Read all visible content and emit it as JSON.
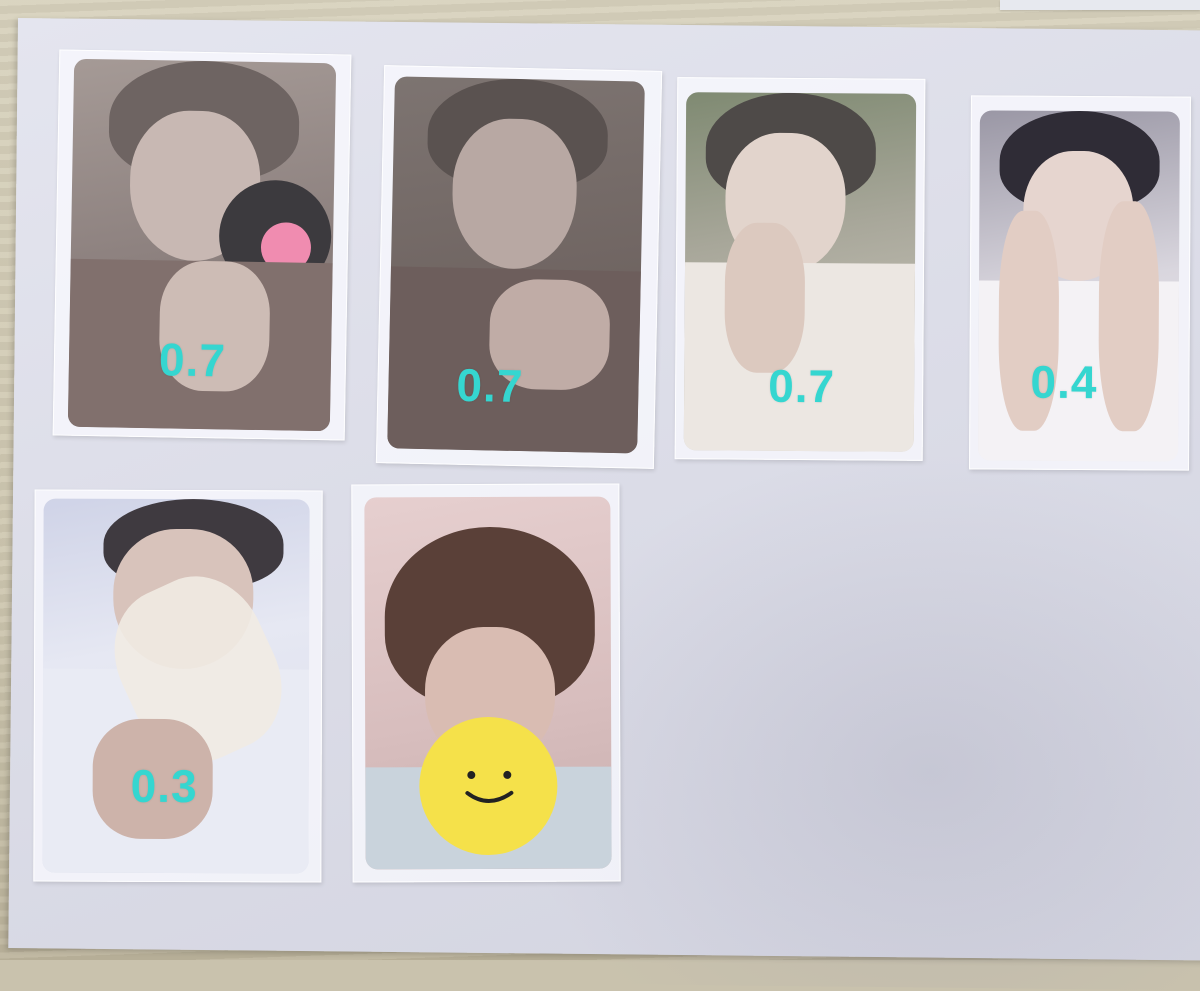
{
  "cards": [
    {
      "price": "0.7"
    },
    {
      "price": "0.7"
    },
    {
      "price": "0.7"
    },
    {
      "price": "0.4"
    },
    {
      "price": "0.3"
    },
    {
      "price": ""
    }
  ],
  "colors": {
    "price_text": "#35d6d0",
    "smiley": "#f5e14a",
    "record_label": "#f08cb0"
  },
  "icons": [
    "smiley-face-sticker"
  ]
}
